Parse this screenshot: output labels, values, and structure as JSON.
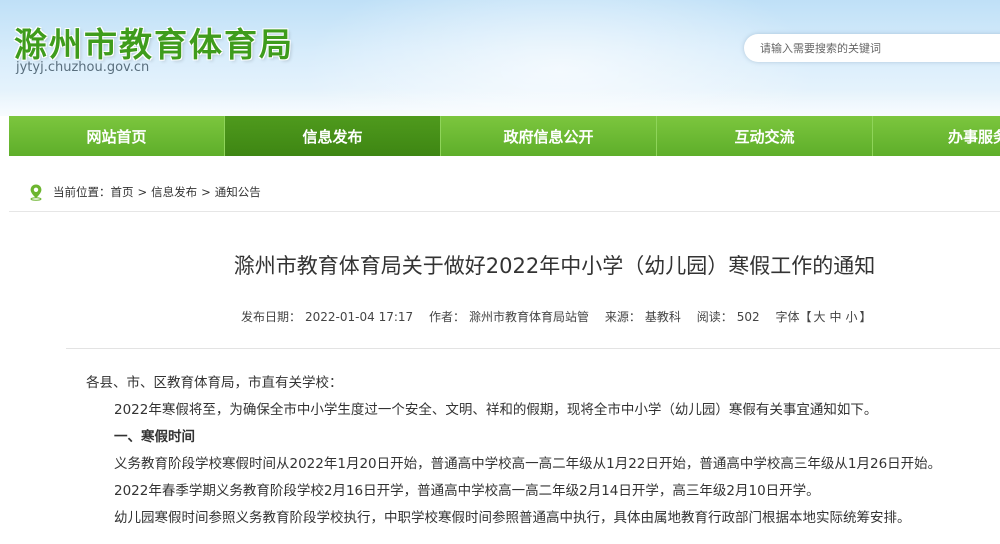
{
  "header": {
    "title": "滁州市教育体育局",
    "domain": "jytyj.chuzhou.gov.cn",
    "search_placeholder": "请输入需要搜索的关键词"
  },
  "nav": {
    "items": [
      {
        "label": "网站首页",
        "active": false
      },
      {
        "label": "信息发布",
        "active": true
      },
      {
        "label": "政府信息公开",
        "active": false
      },
      {
        "label": "互动交流",
        "active": false
      },
      {
        "label": "办事服务",
        "active": false
      }
    ]
  },
  "breadcrumb": {
    "prefix": "当前位置：",
    "items": [
      "首页",
      "信息发布",
      "通知公告"
    ],
    "separator": ">"
  },
  "article": {
    "title": "滁州市教育体育局关于做好2022年中小学（幼儿园）寒假工作的通知",
    "meta": {
      "date_label": "发布日期：",
      "date": "2022-01-04 17:17",
      "author_label": "作者：",
      "author": "滁州市教育体育局站管",
      "source_label": "来源：",
      "source": "基教科",
      "views_label": "阅读：",
      "views": "502",
      "fontsize_label": "字体【",
      "fontsize_large": "大",
      "fontsize_medium": "中",
      "fontsize_small": "小",
      "fontsize_close": "】"
    },
    "paragraphs": [
      "各县、市、区教育体育局，市直有关学校：",
      "2022年寒假将至，为确保全市中小学生度过一个安全、文明、祥和的假期，现将全市中小学（幼儿园）寒假有关事宜通知如下。",
      "一、寒假时间",
      "义务教育阶段学校寒假时间从2022年1月20日开始，普通高中学校高一高二年级从1月22日开始，普通高中学校高三年级从1月26日开始。",
      "2022年春季学期义务教育阶段学校2月16日开学，普通高中学校高一高二年级2月14日开学，高三年级2月10日开学。",
      "幼儿园寒假时间参照义务教育阶段学校执行，中职学校寒假时间参照普通高中执行，具体由属地教育行政部门根据本地实际统筹安排。"
    ]
  },
  "colors": {
    "nav_green": "#5eae2a",
    "nav_active": "#3e8613",
    "title_green": "#3f9c1c"
  }
}
